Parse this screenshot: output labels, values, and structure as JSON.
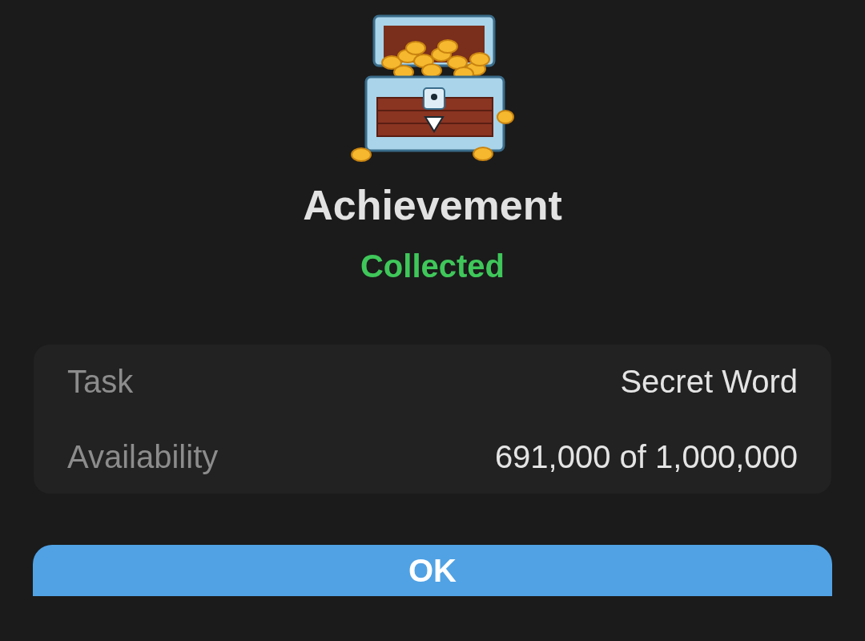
{
  "header": {
    "title": "Achievement",
    "status": "Collected"
  },
  "details": [
    {
      "label": "Task",
      "value": "Secret Word"
    },
    {
      "label": "Availability",
      "value": "691,000 of 1,000,000"
    }
  ],
  "buttons": [
    {
      "label": "OK"
    }
  ]
}
